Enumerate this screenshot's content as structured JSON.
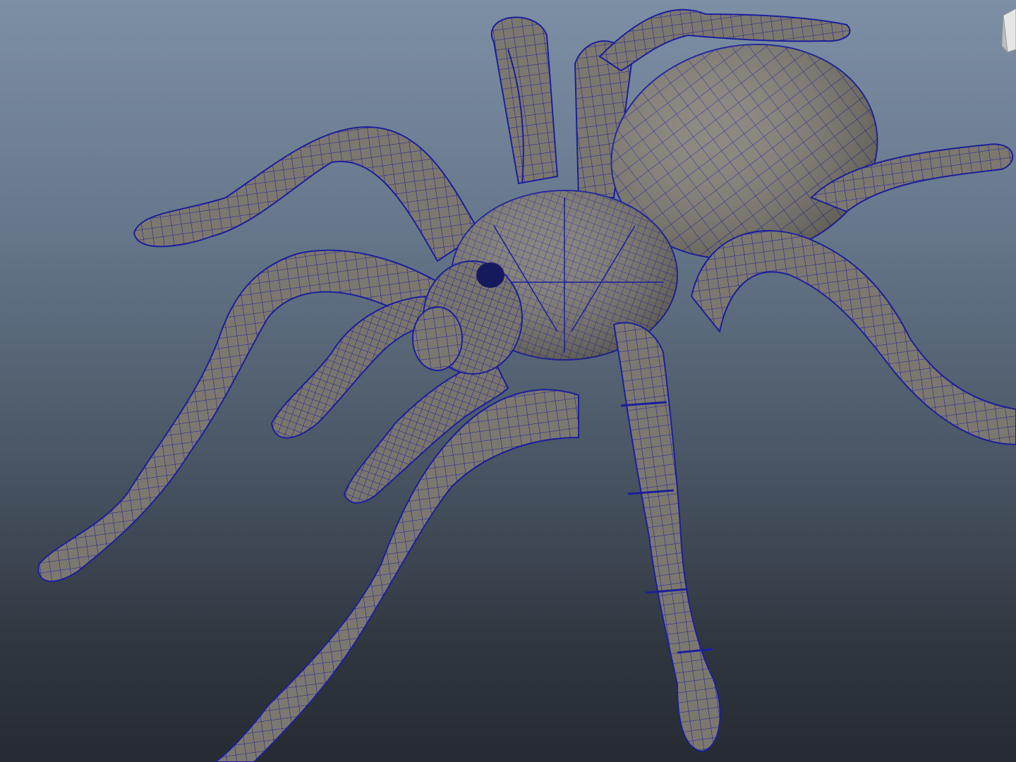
{
  "viewport": {
    "background_top": "#7d8fa5",
    "background_bottom": "#262b31"
  },
  "model": {
    "mesh_fill": "#7d786f",
    "mesh_shadow": "#5e5a54",
    "wire_color": "#1a1f9c",
    "display_mode": "wireframe-on-shaded"
  },
  "view_cube": {
    "icon": "view-cube-icon",
    "face_color": "#e6e6e6"
  }
}
